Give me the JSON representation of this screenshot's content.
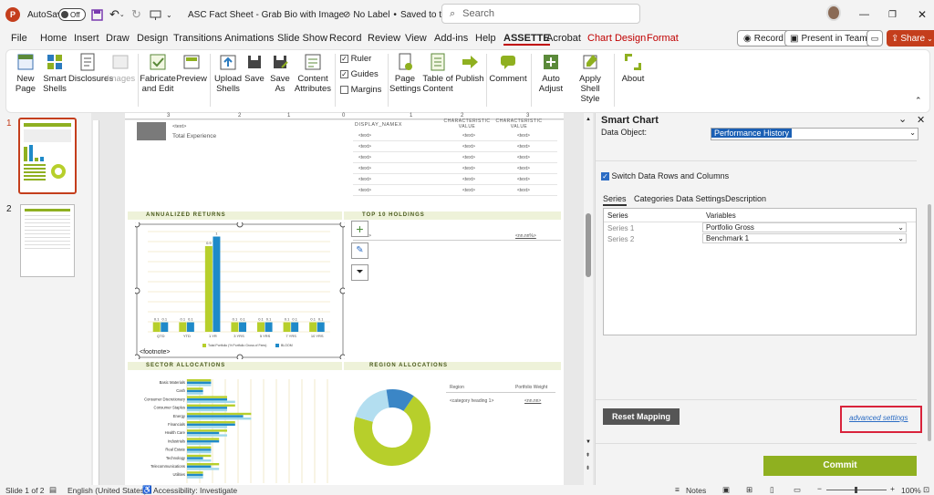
{
  "titlebar": {
    "autosave_label": "AutoSave",
    "autosave_state": "Off",
    "doc_title": "ASC Fact Sheet - Grab Bio with Image",
    "label_status": "No Label",
    "save_status": "Saved to this PC",
    "search_placeholder": "Search"
  },
  "menu_tabs": [
    "File",
    "Home",
    "Insert",
    "Draw",
    "Design",
    "Transitions",
    "Animations",
    "Slide Show",
    "Record",
    "Review",
    "View",
    "Add-ins",
    "Help",
    "ASSETTE",
    "Acrobat",
    "Chart Design",
    "Format"
  ],
  "right_buttons": {
    "record": "Record",
    "present": "Present in Teams",
    "share": "Share"
  },
  "ribbon": {
    "new_page": "New Page",
    "smart_shells": "Smart Shells",
    "disclosures": "Disclosures",
    "images": "Images",
    "fabricate": "Fabricate and Edit",
    "preview": "Preview",
    "upload": "Upload Shells",
    "save": "Save",
    "save_as": "Save As",
    "content_attr": "Content Attributes",
    "ruler": "Ruler",
    "guides": "Guides",
    "margins": "Margins",
    "page_settings": "Page Settings",
    "toc": "Table of Content",
    "publish": "Publish",
    "comment": "Comment",
    "auto_adjust": "Auto Adjust",
    "apply_shell": "Apply Shell Style",
    "about": "About"
  },
  "thumbs": {
    "n1": "1",
    "n2": "2"
  },
  "ruler_labels": [
    "3",
    "2",
    "1",
    "0",
    "1",
    "2",
    "3"
  ],
  "slide": {
    "total_exp_text": "<text>",
    "total_exp_label": "Total Experience",
    "display_name": "DISPLAY_NAMEX",
    "char_value1": "CHARACTERISTIC VALUE",
    "char_value2": "CHARACTERISTIC VALUE",
    "text_cell": "<text>",
    "annualized": "ANNUALIZED RETURNS",
    "top10": "TOP 10 HOLDINGS",
    "top10_val": "<nn.nn%>",
    "footnote": "<footnote>",
    "sector": "SECTOR ALLOCATIONS",
    "region": "REGION ALLOCATIONS",
    "region_col1": "Region",
    "region_col2": "Portfolio Weight",
    "region_row": "<category heading 1>",
    "region_val": "<nn.nn>"
  },
  "chart_data": [
    {
      "type": "bar",
      "title": "ANNUALIZED RETURNS",
      "categories": [
        "QTD",
        "YTD",
        "1 YR",
        "3 YRS",
        "5 YRS",
        "7 YRS",
        "10 YRS"
      ],
      "series": [
        {
          "name": "Total Portfolio (% Portfolio Gross of Fees)",
          "values": [
            0.1,
            0.1,
            0.9,
            0.1,
            0.1,
            0.1,
            0.1
          ]
        },
        {
          "name": "BLOOM",
          "values": [
            0.1,
            0.1,
            1,
            0.1,
            0.1,
            0.1,
            0.1
          ]
        }
      ],
      "ylim": [
        0,
        1
      ],
      "colors": [
        "#b7cf2b",
        "#1f8ac9"
      ]
    },
    {
      "type": "bar",
      "title": "SECTOR ALLOCATIONS",
      "categories": [
        "Basic Materials",
        "Cash",
        "Consumer Discretionary",
        "Consumer Staples",
        "Energy",
        "Financials",
        "Health Care",
        "Industrials",
        "Real Estate",
        "Technology",
        "Telecommunications",
        "Utilities"
      ],
      "series": [
        {
          "values": [
            0.3,
            0.2,
            0.5,
            0.6,
            0.8,
            0.6,
            0.5,
            0.4,
            0.3,
            0.3,
            0.4,
            0.2
          ]
        },
        {
          "values": [
            0.3,
            0.2,
            0.5,
            0.5,
            0.7,
            0.6,
            0.4,
            0.4,
            0.3,
            0.2,
            0.3,
            0.2
          ]
        },
        {
          "values": [
            0.3,
            0.2,
            0.6,
            0.5,
            0.8,
            0.5,
            0.5,
            0.3,
            0.3,
            0.3,
            0.4,
            0.2
          ]
        }
      ],
      "colors": [
        "#b7cf2b",
        "#1f8ac9",
        "#9fd7ea"
      ]
    },
    {
      "type": "pie",
      "title": "REGION ALLOCATIONS",
      "values": [
        70,
        18,
        12
      ],
      "colors": [
        "#b7cf2b",
        "#b3def0",
        "#3b86c6"
      ]
    }
  ],
  "pane": {
    "title": "Smart Chart",
    "data_object_label": "Data Object:",
    "data_object_value": "Performance History",
    "switch_label": "Switch Data Rows and Columns",
    "tabs": [
      "Series",
      "Categories",
      "Data Settings",
      "Description"
    ],
    "col_series": "Series",
    "col_variables": "Variables",
    "rows": [
      {
        "series": "Series 1",
        "variable": "Portfolio Gross"
      },
      {
        "series": "Series 2",
        "variable": "Benchmark 1"
      }
    ],
    "reset": "Reset Mapping",
    "advanced": "advanced settings",
    "commit": "Commit"
  },
  "status": {
    "slide": "Slide 1 of 2",
    "language": "English (United States)",
    "accessibility": "Accessibility: Investigate",
    "notes": "Notes",
    "zoom": "100%"
  },
  "colors": {
    "assette": "#c00000",
    "green": "#8fb020",
    "share": "#c43e1c",
    "highlight": "#d9233b"
  }
}
